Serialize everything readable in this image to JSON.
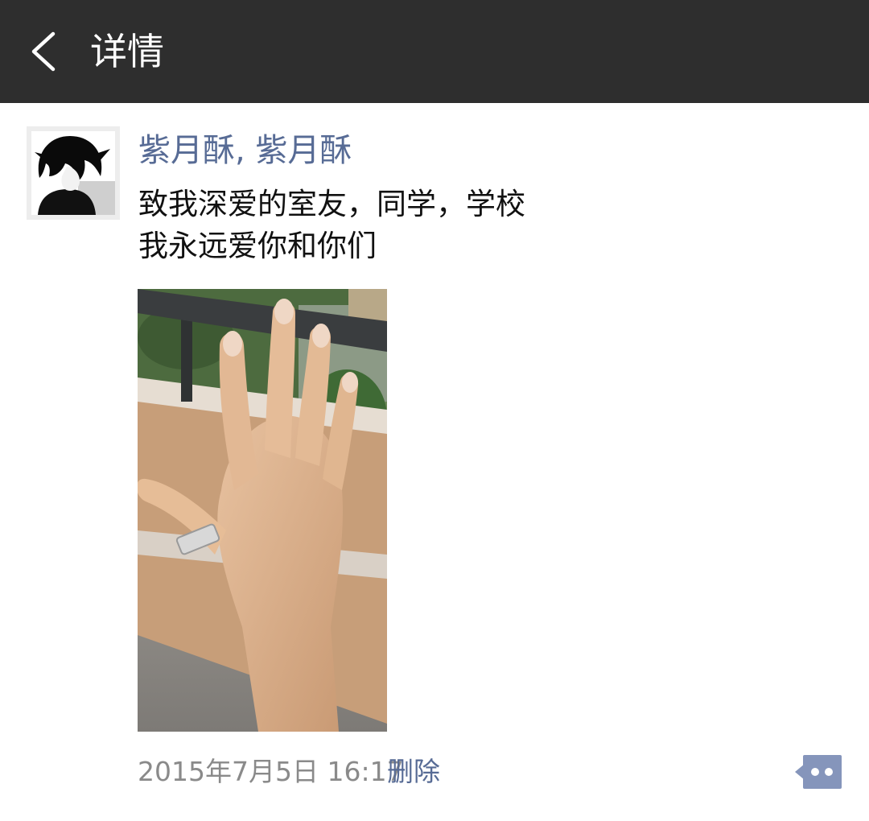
{
  "navbar": {
    "title": "详情",
    "back_icon": "chevron-left-icon"
  },
  "post": {
    "author": "紫月酥, 紫月酥",
    "text_lines": [
      "致我深爱的室友，同学，学校",
      "我永远爱你和你们"
    ],
    "timestamp": "2015年7月5日 16:17",
    "delete_label": "删除",
    "more_icon": "comment-more-icon"
  },
  "colors": {
    "navbar_bg": "#2e2e2e",
    "link": "#576b95",
    "meta_text": "#8a8a8a",
    "more_button_bg": "#8595bb"
  }
}
